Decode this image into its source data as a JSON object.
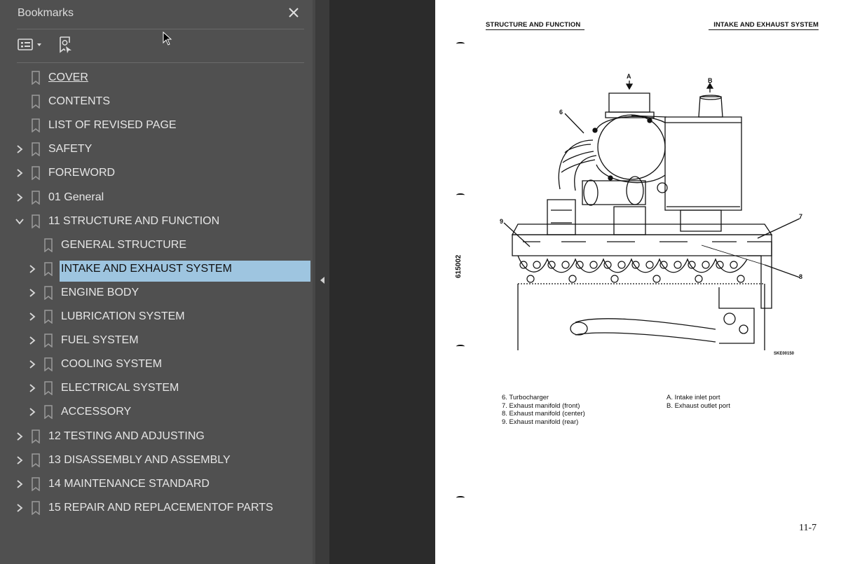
{
  "bookmarks_panel": {
    "title": "Bookmarks",
    "items": [
      {
        "label": "COVER",
        "level": 0,
        "expandable": false
      },
      {
        "label": "CONTENTS",
        "level": 0,
        "expandable": false
      },
      {
        "label": "LIST OF REVISED PAGE",
        "level": 0,
        "expandable": false
      },
      {
        "label": "SAFETY",
        "level": 0,
        "expandable": true
      },
      {
        "label": "FOREWORD",
        "level": 0,
        "expandable": true
      },
      {
        "label": "01 General",
        "level": 0,
        "expandable": true
      },
      {
        "label": "11 STRUCTURE AND FUNCTION",
        "level": 0,
        "expandable": true,
        "expanded": true
      },
      {
        "label": "GENERAL STRUCTURE",
        "level": 1,
        "expandable": false
      },
      {
        "label": "INTAKE AND EXHAUST SYSTEM",
        "level": 1,
        "expandable": true,
        "selected": true
      },
      {
        "label": "ENGINE BODY",
        "level": 1,
        "expandable": true
      },
      {
        "label": "LUBRICATION SYSTEM",
        "level": 1,
        "expandable": true
      },
      {
        "label": "FUEL SYSTEM",
        "level": 1,
        "expandable": true
      },
      {
        "label": "COOLING SYSTEM",
        "level": 1,
        "expandable": true
      },
      {
        "label": "ELECTRICAL SYSTEM",
        "level": 1,
        "expandable": true
      },
      {
        "label": "ACCESSORY",
        "level": 1,
        "expandable": true
      },
      {
        "label": "12 TESTING AND ADJUSTING",
        "level": 0,
        "expandable": true
      },
      {
        "label": "13 DISASSEMBLY AND ASSEMBLY",
        "level": 0,
        "expandable": true
      },
      {
        "label": "14 MAINTENANCE STANDARD",
        "level": 0,
        "expandable": true
      },
      {
        "label": "15 REPAIR AND REPLACEMENTOF PARTS",
        "level": 0,
        "expandable": true
      }
    ]
  },
  "document_page": {
    "header_left": "STRUCTURE AND FUNCTION",
    "header_right": "INTAKE AND EXHAUST SYSTEM",
    "side_code": "615002",
    "figure_code": "SKE00150",
    "figure_labels": {
      "a": "A",
      "b": "B",
      "n6": "6",
      "n7": "7",
      "n8": "8",
      "n9": "9"
    },
    "captions_left": [
      "6. Turbocharger",
      "7. Exhaust manifold (front)",
      "8. Exhaust manifold (center)",
      "9. Exhaust manifold (rear)"
    ],
    "captions_right": [
      "A. Intake inlet port",
      "B. Exhaust outlet port"
    ],
    "page_number": "11-7"
  },
  "colors": {
    "panel_bg": "#505050",
    "selection": "#9ec5e0",
    "viewer_bg": "#2b2b2b"
  }
}
